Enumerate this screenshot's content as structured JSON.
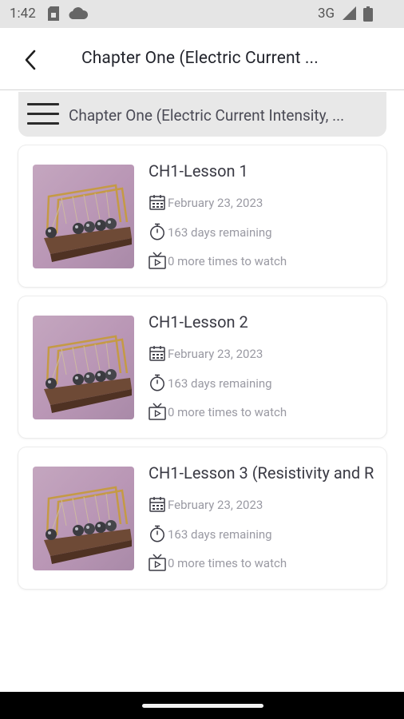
{
  "status_bar": {
    "time": "1:42",
    "network": "3G"
  },
  "header": {
    "title": "Chapter One (Electric Current ..."
  },
  "chapter_bar": {
    "text": "Chapter One (Electric Current Intensity, ..."
  },
  "lessons": [
    {
      "title": "CH1-Lesson 1",
      "date": "February 23, 2023",
      "remaining": "163  days remaining",
      "watch": "0 more times to watch"
    },
    {
      "title": "CH1-Lesson 2",
      "date": "February 23, 2023",
      "remaining": "163  days remaining",
      "watch": "0 more times to watch"
    },
    {
      "title": "CH1-Lesson 3 (Resistivity and R",
      "date": "February 23, 2023",
      "remaining": "163  days remaining",
      "watch": "0 more times to watch"
    }
  ],
  "icons": {
    "back": "chevron-left-icon",
    "menu": "hamburger-menu-icon",
    "date": "calendar-icon",
    "remaining": "stopwatch-icon",
    "watch": "tv-play-icon"
  },
  "colors": {
    "status_bar": "#e5e5e5",
    "chapter_bar": "#e8e8e8",
    "meta_text": "#9a9aa3"
  }
}
